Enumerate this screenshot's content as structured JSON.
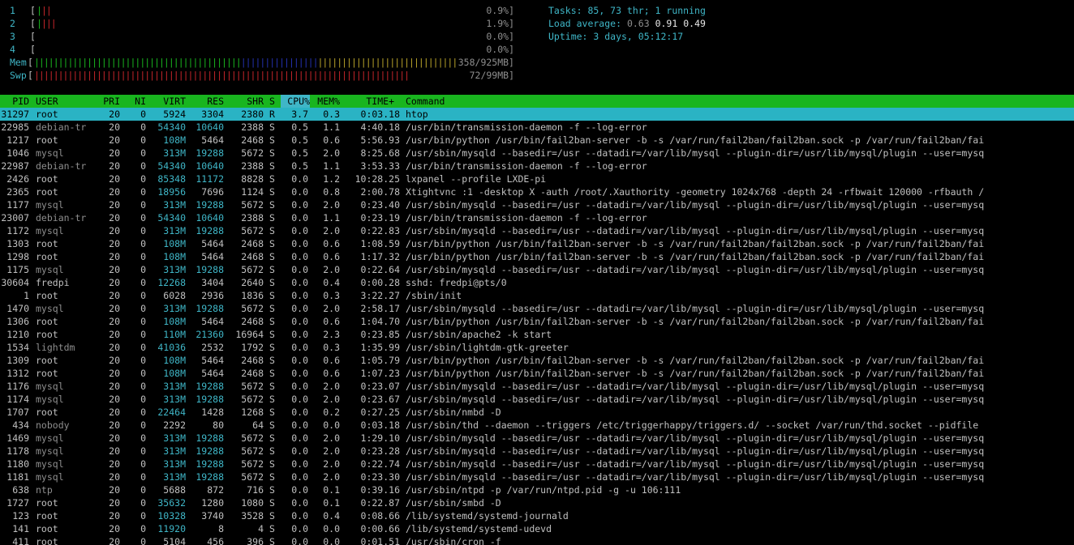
{
  "colors": {
    "background": "#000000",
    "header_bar": "#19b51f",
    "selection": "#2ab3c4",
    "cyan": "#3fb6c7",
    "green": "#19b51f",
    "red": "#c8262b",
    "blue": "#2431b0",
    "yellow": "#b8a32a"
  },
  "meters": [
    {
      "label": "1",
      "value": "0.9%]",
      "level": 0.009,
      "bars": [
        {
          "color": "#19b51f",
          "count": 1
        },
        {
          "color": "#c8262b",
          "count": 2
        }
      ]
    },
    {
      "label": "2",
      "value": "1.9%]",
      "level": 0.019,
      "bars": [
        {
          "color": "#19b51f",
          "count": 1
        },
        {
          "color": "#c8262b",
          "count": 3
        }
      ]
    },
    {
      "label": "3",
      "value": "0.0%]",
      "level": 0.0,
      "bars": []
    },
    {
      "label": "4",
      "value": "0.0%]",
      "level": 0.0,
      "bars": []
    },
    {
      "label": "Mem",
      "value": "358/925MB]",
      "level": 0.387,
      "bars": [
        {
          "color": "#19b51f",
          "count": 43
        },
        {
          "color": "#2431b0",
          "count": 16
        },
        {
          "color": "#b8a32a",
          "count": 34
        }
      ]
    },
    {
      "label": "Swp",
      "value": "72/99MB]",
      "level": 0.727,
      "bars": [
        {
          "color": "#c8262b",
          "count": 78
        }
      ]
    }
  ],
  "summary": {
    "tasks_label": "Tasks: ",
    "tasks_value": "85, 73 thr; 1 running",
    "load_label": "Load average: ",
    "load_1": "0.63",
    "load_5": "0.91",
    "load_15": "0.49",
    "uptime_label": "Uptime: ",
    "uptime_value": "3 days, 05:12:17"
  },
  "header": {
    "pid": "PID",
    "user": "USER",
    "pri": "PRI",
    "ni": "NI",
    "virt": "VIRT",
    "res": "RES",
    "shr": "SHR",
    "s": "S",
    "cpu": "CPU%",
    "mem": "MEM%",
    "time": "TIME+",
    "command": "Command"
  },
  "processes": [
    {
      "pid": "31297",
      "user": "root",
      "pri": "20",
      "ni": "0",
      "virt": "5924",
      "res": "3304",
      "shr": "2380",
      "s": "R",
      "cpu": "3.7",
      "mem": "0.3",
      "time": "0:03.18",
      "command": "htop",
      "selected": true
    },
    {
      "pid": "22985",
      "user": "debian-tr",
      "pri": "20",
      "ni": "0",
      "virt": "54340",
      "res": "10640",
      "shr": "2388",
      "s": "S",
      "cpu": "0.5",
      "mem": "1.1",
      "time": "4:40.18",
      "command": "/usr/bin/transmission-daemon -f --log-error"
    },
    {
      "pid": "1217",
      "user": "root",
      "pri": "20",
      "ni": "0",
      "virt": "108M",
      "res": "5464",
      "shr": "2468",
      "s": "S",
      "cpu": "0.5",
      "mem": "0.6",
      "time": "5:56.93",
      "command": "/usr/bin/python /usr/bin/fail2ban-server -b -s /var/run/fail2ban/fail2ban.sock -p /var/run/fail2ban/fai"
    },
    {
      "pid": "1046",
      "user": "mysql",
      "pri": "20",
      "ni": "0",
      "virt": "313M",
      "res": "19288",
      "shr": "5672",
      "s": "S",
      "cpu": "0.5",
      "mem": "2.0",
      "time": "8:25.68",
      "command": "/usr/sbin/mysqld --basedir=/usr --datadir=/var/lib/mysql --plugin-dir=/usr/lib/mysql/plugin --user=mysq"
    },
    {
      "pid": "22987",
      "user": "debian-tr",
      "pri": "20",
      "ni": "0",
      "virt": "54340",
      "res": "10640",
      "shr": "2388",
      "s": "S",
      "cpu": "0.5",
      "mem": "1.1",
      "time": "3:53.33",
      "command": "/usr/bin/transmission-daemon -f --log-error"
    },
    {
      "pid": "2426",
      "user": "root",
      "pri": "20",
      "ni": "0",
      "virt": "85348",
      "res": "11172",
      "shr": "8828",
      "s": "S",
      "cpu": "0.0",
      "mem": "1.2",
      "time": "10:28.25",
      "command": "lxpanel --profile LXDE-pi"
    },
    {
      "pid": "2365",
      "user": "root",
      "pri": "20",
      "ni": "0",
      "virt": "18956",
      "res": "7696",
      "shr": "1124",
      "s": "S",
      "cpu": "0.0",
      "mem": "0.8",
      "time": "2:00.78",
      "command": "Xtightvnc :1 -desktop X -auth /root/.Xauthority -geometry 1024x768 -depth 24 -rfbwait 120000 -rfbauth /"
    },
    {
      "pid": "1177",
      "user": "mysql",
      "pri": "20",
      "ni": "0",
      "virt": "313M",
      "res": "19288",
      "shr": "5672",
      "s": "S",
      "cpu": "0.0",
      "mem": "2.0",
      "time": "0:23.40",
      "command": "/usr/sbin/mysqld --basedir=/usr --datadir=/var/lib/mysql --plugin-dir=/usr/lib/mysql/plugin --user=mysq"
    },
    {
      "pid": "23007",
      "user": "debian-tr",
      "pri": "20",
      "ni": "0",
      "virt": "54340",
      "res": "10640",
      "shr": "2388",
      "s": "S",
      "cpu": "0.0",
      "mem": "1.1",
      "time": "0:23.19",
      "command": "/usr/bin/transmission-daemon -f --log-error"
    },
    {
      "pid": "1172",
      "user": "mysql",
      "pri": "20",
      "ni": "0",
      "virt": "313M",
      "res": "19288",
      "shr": "5672",
      "s": "S",
      "cpu": "0.0",
      "mem": "2.0",
      "time": "0:22.83",
      "command": "/usr/sbin/mysqld --basedir=/usr --datadir=/var/lib/mysql --plugin-dir=/usr/lib/mysql/plugin --user=mysq"
    },
    {
      "pid": "1303",
      "user": "root",
      "pri": "20",
      "ni": "0",
      "virt": "108M",
      "res": "5464",
      "shr": "2468",
      "s": "S",
      "cpu": "0.0",
      "mem": "0.6",
      "time": "1:08.59",
      "command": "/usr/bin/python /usr/bin/fail2ban-server -b -s /var/run/fail2ban/fail2ban.sock -p /var/run/fail2ban/fai"
    },
    {
      "pid": "1298",
      "user": "root",
      "pri": "20",
      "ni": "0",
      "virt": "108M",
      "res": "5464",
      "shr": "2468",
      "s": "S",
      "cpu": "0.0",
      "mem": "0.6",
      "time": "1:17.32",
      "command": "/usr/bin/python /usr/bin/fail2ban-server -b -s /var/run/fail2ban/fail2ban.sock -p /var/run/fail2ban/fai"
    },
    {
      "pid": "1175",
      "user": "mysql",
      "pri": "20",
      "ni": "0",
      "virt": "313M",
      "res": "19288",
      "shr": "5672",
      "s": "S",
      "cpu": "0.0",
      "mem": "2.0",
      "time": "0:22.64",
      "command": "/usr/sbin/mysqld --basedir=/usr --datadir=/var/lib/mysql --plugin-dir=/usr/lib/mysql/plugin --user=mysq"
    },
    {
      "pid": "30604",
      "user": "fredpi",
      "pri": "20",
      "ni": "0",
      "virt": "12268",
      "res": "3404",
      "shr": "2640",
      "s": "S",
      "cpu": "0.0",
      "mem": "0.4",
      "time": "0:00.28",
      "command": "sshd: fredpi@pts/0"
    },
    {
      "pid": "1",
      "user": "root",
      "pri": "20",
      "ni": "0",
      "virt": "6028",
      "res": "2936",
      "shr": "1836",
      "s": "S",
      "cpu": "0.0",
      "mem": "0.3",
      "time": "3:22.27",
      "command": "/sbin/init"
    },
    {
      "pid": "1470",
      "user": "mysql",
      "pri": "20",
      "ni": "0",
      "virt": "313M",
      "res": "19288",
      "shr": "5672",
      "s": "S",
      "cpu": "0.0",
      "mem": "2.0",
      "time": "2:58.17",
      "command": "/usr/sbin/mysqld --basedir=/usr --datadir=/var/lib/mysql --plugin-dir=/usr/lib/mysql/plugin --user=mysq"
    },
    {
      "pid": "1306",
      "user": "root",
      "pri": "20",
      "ni": "0",
      "virt": "108M",
      "res": "5464",
      "shr": "2468",
      "s": "S",
      "cpu": "0.0",
      "mem": "0.6",
      "time": "1:04.70",
      "command": "/usr/bin/python /usr/bin/fail2ban-server -b -s /var/run/fail2ban/fail2ban.sock -p /var/run/fail2ban/fai"
    },
    {
      "pid": "1210",
      "user": "root",
      "pri": "20",
      "ni": "0",
      "virt": "110M",
      "res": "21360",
      "shr": "16964",
      "s": "S",
      "cpu": "0.0",
      "mem": "2.3",
      "time": "0:23.85",
      "command": "/usr/sbin/apache2 -k start"
    },
    {
      "pid": "1534",
      "user": "lightdm",
      "pri": "20",
      "ni": "0",
      "virt": "41036",
      "res": "2532",
      "shr": "1792",
      "s": "S",
      "cpu": "0.0",
      "mem": "0.3",
      "time": "1:35.99",
      "command": "/usr/sbin/lightdm-gtk-greeter"
    },
    {
      "pid": "1309",
      "user": "root",
      "pri": "20",
      "ni": "0",
      "virt": "108M",
      "res": "5464",
      "shr": "2468",
      "s": "S",
      "cpu": "0.0",
      "mem": "0.6",
      "time": "1:05.79",
      "command": "/usr/bin/python /usr/bin/fail2ban-server -b -s /var/run/fail2ban/fail2ban.sock -p /var/run/fail2ban/fai"
    },
    {
      "pid": "1312",
      "user": "root",
      "pri": "20",
      "ni": "0",
      "virt": "108M",
      "res": "5464",
      "shr": "2468",
      "s": "S",
      "cpu": "0.0",
      "mem": "0.6",
      "time": "1:07.23",
      "command": "/usr/bin/python /usr/bin/fail2ban-server -b -s /var/run/fail2ban/fail2ban.sock -p /var/run/fail2ban/fai"
    },
    {
      "pid": "1176",
      "user": "mysql",
      "pri": "20",
      "ni": "0",
      "virt": "313M",
      "res": "19288",
      "shr": "5672",
      "s": "S",
      "cpu": "0.0",
      "mem": "2.0",
      "time": "0:23.07",
      "command": "/usr/sbin/mysqld --basedir=/usr --datadir=/var/lib/mysql --plugin-dir=/usr/lib/mysql/plugin --user=mysq"
    },
    {
      "pid": "1174",
      "user": "mysql",
      "pri": "20",
      "ni": "0",
      "virt": "313M",
      "res": "19288",
      "shr": "5672",
      "s": "S",
      "cpu": "0.0",
      "mem": "2.0",
      "time": "0:23.67",
      "command": "/usr/sbin/mysqld --basedir=/usr --datadir=/var/lib/mysql --plugin-dir=/usr/lib/mysql/plugin --user=mysq"
    },
    {
      "pid": "1707",
      "user": "root",
      "pri": "20",
      "ni": "0",
      "virt": "22464",
      "res": "1428",
      "shr": "1268",
      "s": "S",
      "cpu": "0.0",
      "mem": "0.2",
      "time": "0:27.25",
      "command": "/usr/sbin/nmbd -D"
    },
    {
      "pid": "434",
      "user": "nobody",
      "pri": "20",
      "ni": "0",
      "virt": "2292",
      "res": "80",
      "shr": "64",
      "s": "S",
      "cpu": "0.0",
      "mem": "0.0",
      "time": "0:03.18",
      "command": "/usr/sbin/thd --daemon --triggers /etc/triggerhappy/triggers.d/ --socket /var/run/thd.socket --pidfile"
    },
    {
      "pid": "1469",
      "user": "mysql",
      "pri": "20",
      "ni": "0",
      "virt": "313M",
      "res": "19288",
      "shr": "5672",
      "s": "S",
      "cpu": "0.0",
      "mem": "2.0",
      "time": "1:29.10",
      "command": "/usr/sbin/mysqld --basedir=/usr --datadir=/var/lib/mysql --plugin-dir=/usr/lib/mysql/plugin --user=mysq"
    },
    {
      "pid": "1178",
      "user": "mysql",
      "pri": "20",
      "ni": "0",
      "virt": "313M",
      "res": "19288",
      "shr": "5672",
      "s": "S",
      "cpu": "0.0",
      "mem": "2.0",
      "time": "0:23.28",
      "command": "/usr/sbin/mysqld --basedir=/usr --datadir=/var/lib/mysql --plugin-dir=/usr/lib/mysql/plugin --user=mysq"
    },
    {
      "pid": "1180",
      "user": "mysql",
      "pri": "20",
      "ni": "0",
      "virt": "313M",
      "res": "19288",
      "shr": "5672",
      "s": "S",
      "cpu": "0.0",
      "mem": "2.0",
      "time": "0:22.74",
      "command": "/usr/sbin/mysqld --basedir=/usr --datadir=/var/lib/mysql --plugin-dir=/usr/lib/mysql/plugin --user=mysq"
    },
    {
      "pid": "1181",
      "user": "mysql",
      "pri": "20",
      "ni": "0",
      "virt": "313M",
      "res": "19288",
      "shr": "5672",
      "s": "S",
      "cpu": "0.0",
      "mem": "2.0",
      "time": "0:23.30",
      "command": "/usr/sbin/mysqld --basedir=/usr --datadir=/var/lib/mysql --plugin-dir=/usr/lib/mysql/plugin --user=mysq"
    },
    {
      "pid": "638",
      "user": "ntp",
      "pri": "20",
      "ni": "0",
      "virt": "5688",
      "res": "872",
      "shr": "716",
      "s": "S",
      "cpu": "0.0",
      "mem": "0.1",
      "time": "0:39.16",
      "command": "/usr/sbin/ntpd -p /var/run/ntpd.pid -g -u 106:111"
    },
    {
      "pid": "1727",
      "user": "root",
      "pri": "20",
      "ni": "0",
      "virt": "35632",
      "res": "1280",
      "shr": "1080",
      "s": "S",
      "cpu": "0.0",
      "mem": "0.1",
      "time": "0:22.87",
      "command": "/usr/sbin/smbd -D"
    },
    {
      "pid": "123",
      "user": "root",
      "pri": "20",
      "ni": "0",
      "virt": "10328",
      "res": "3740",
      "shr": "3528",
      "s": "S",
      "cpu": "0.0",
      "mem": "0.4",
      "time": "0:08.66",
      "command": "/lib/systemd/systemd-journald"
    },
    {
      "pid": "141",
      "user": "root",
      "pri": "20",
      "ni": "0",
      "virt": "11920",
      "res": "8",
      "shr": "4",
      "s": "S",
      "cpu": "0.0",
      "mem": "0.0",
      "time": "0:00.66",
      "command": "/lib/systemd/systemd-udevd"
    },
    {
      "pid": "411",
      "user": "root",
      "pri": "20",
      "ni": "0",
      "virt": "5104",
      "res": "456",
      "shr": "396",
      "s": "S",
      "cpu": "0.0",
      "mem": "0.0",
      "time": "0:01.51",
      "command": "/usr/sbin/cron -f"
    }
  ]
}
